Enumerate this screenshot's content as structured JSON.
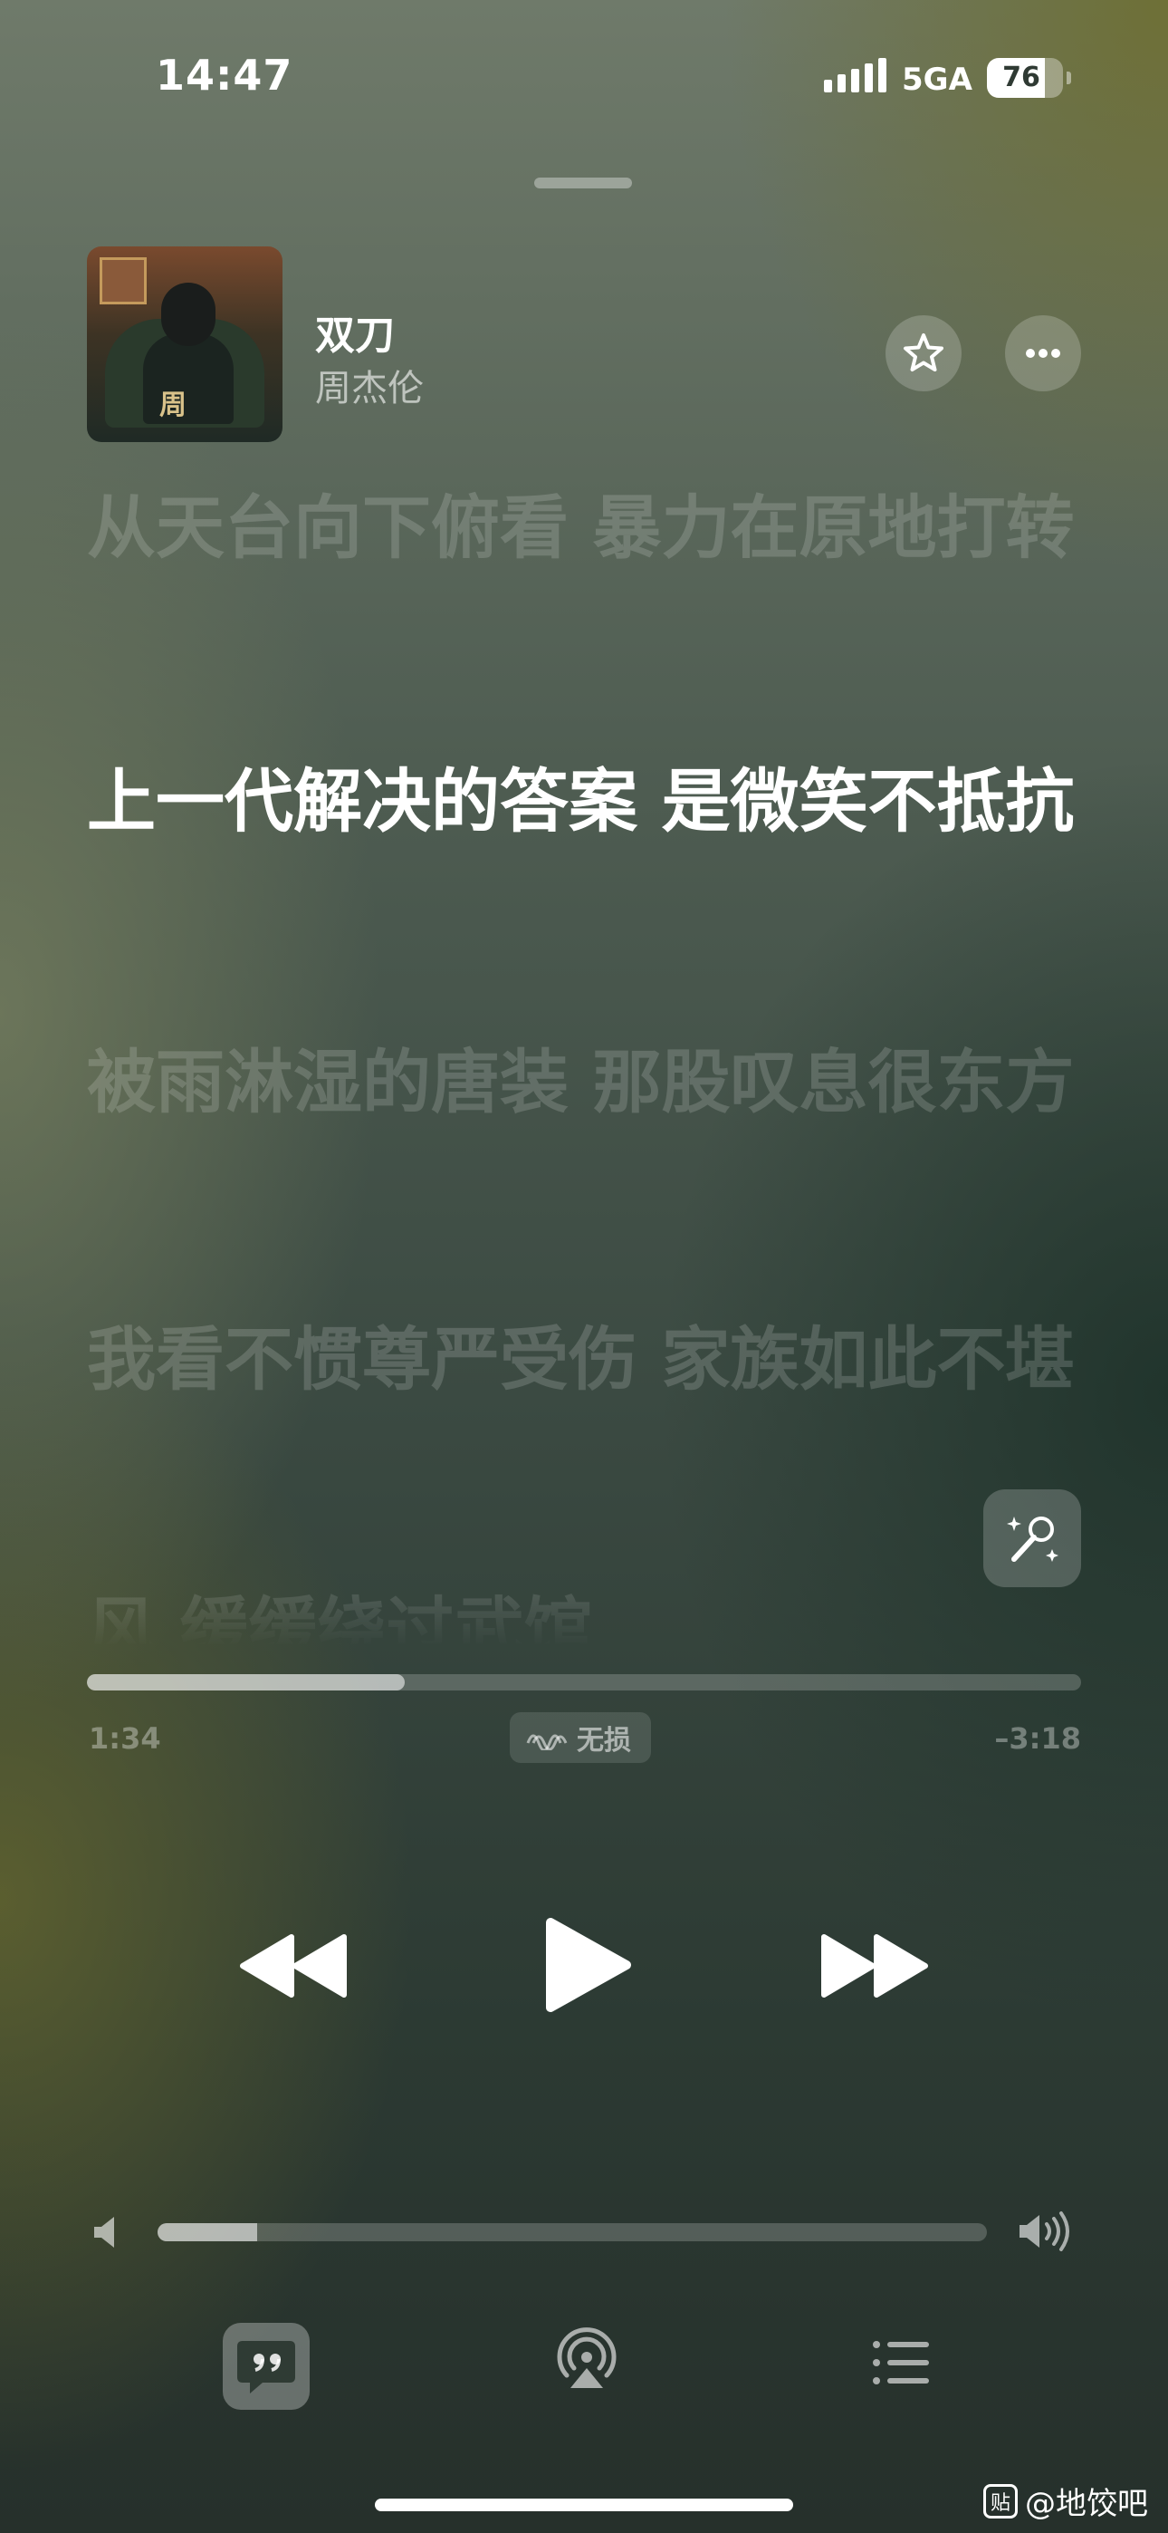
{
  "status_bar": {
    "time": "14:47",
    "network": "5GA",
    "battery_level": 76,
    "battery_text": "76"
  },
  "now_playing": {
    "title": "双刀",
    "artist": "周杰伦",
    "album_art_text": "周"
  },
  "lyrics": [
    "从天台向下俯看 暴力在原地打转",
    "上一代解决的答案 是微笑不抵抗",
    "被雨淋湿的唐装 那股叹息很东方",
    "我看不惯尊严受伤 家族如此不堪",
    "风 缓缓绕过武馆"
  ],
  "active_lyric_index": 1,
  "playback": {
    "elapsed": "1:34",
    "remaining": "–3:18",
    "progress_fraction": 0.32,
    "quality_label": "无损"
  },
  "volume": {
    "level_fraction": 0.12
  },
  "watermark": {
    "logo": "贴",
    "text": "@地饺吧"
  },
  "icons": {
    "favorite": "star-icon",
    "more": "ellipsis-icon",
    "sing": "microphone-sparkle-icon",
    "previous": "backward-icon",
    "play": "play-icon",
    "next": "forward-icon",
    "lyrics": "quote-bubble-icon",
    "airplay": "airplay-icon",
    "queue": "list-icon"
  }
}
